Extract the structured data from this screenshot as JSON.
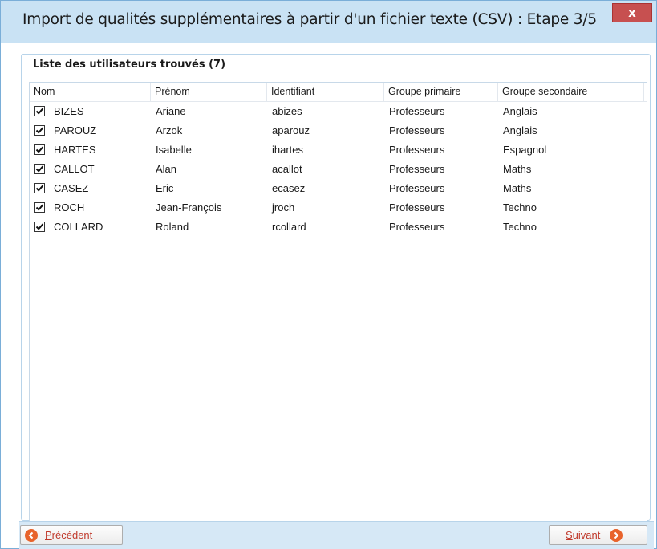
{
  "window": {
    "title": "Import de qualités supplémentaires à partir d'un fichier texte (CSV) : Etape 3/5",
    "close_glyph": "x"
  },
  "group": {
    "legend": "Liste des utilisateurs trouvés (7)"
  },
  "table": {
    "columns": [
      "Nom",
      "Prénom",
      "Identifiant",
      "Groupe primaire",
      "Groupe secondaire"
    ],
    "rows": [
      {
        "checked": true,
        "nom": "BIZES",
        "prenom": "Ariane",
        "identifiant": "abizes",
        "groupe_primaire": "Professeurs",
        "groupe_secondaire": "Anglais"
      },
      {
        "checked": true,
        "nom": "PAROUZ",
        "prenom": "Arzok",
        "identifiant": "aparouz",
        "groupe_primaire": "Professeurs",
        "groupe_secondaire": "Anglais"
      },
      {
        "checked": true,
        "nom": "HARTES",
        "prenom": "Isabelle",
        "identifiant": "ihartes",
        "groupe_primaire": "Professeurs",
        "groupe_secondaire": "Espagnol"
      },
      {
        "checked": true,
        "nom": "CALLOT",
        "prenom": "Alan",
        "identifiant": "acallot",
        "groupe_primaire": "Professeurs",
        "groupe_secondaire": "Maths"
      },
      {
        "checked": true,
        "nom": "CASEZ",
        "prenom": "Eric",
        "identifiant": "ecasez",
        "groupe_primaire": "Professeurs",
        "groupe_secondaire": "Maths"
      },
      {
        "checked": true,
        "nom": "ROCH",
        "prenom": "Jean-François",
        "identifiant": "jroch",
        "groupe_primaire": "Professeurs",
        "groupe_secondaire": "Techno"
      },
      {
        "checked": true,
        "nom": "COLLARD",
        "prenom": "Roland",
        "identifiant": "rcollard",
        "groupe_primaire": "Professeurs",
        "groupe_secondaire": "Techno"
      }
    ]
  },
  "buttons": {
    "previous": {
      "first": "P",
      "rest": "récédent",
      "icon": "arrow-left-icon"
    },
    "next": {
      "first": "S",
      "rest": "uivant",
      "icon": "arrow-right-icon"
    }
  },
  "colors": {
    "titlebar": "#c9e2f4",
    "close": "#c75050",
    "accent_icon": "#e8632b",
    "bottom_bar": "#d6e8f6"
  }
}
